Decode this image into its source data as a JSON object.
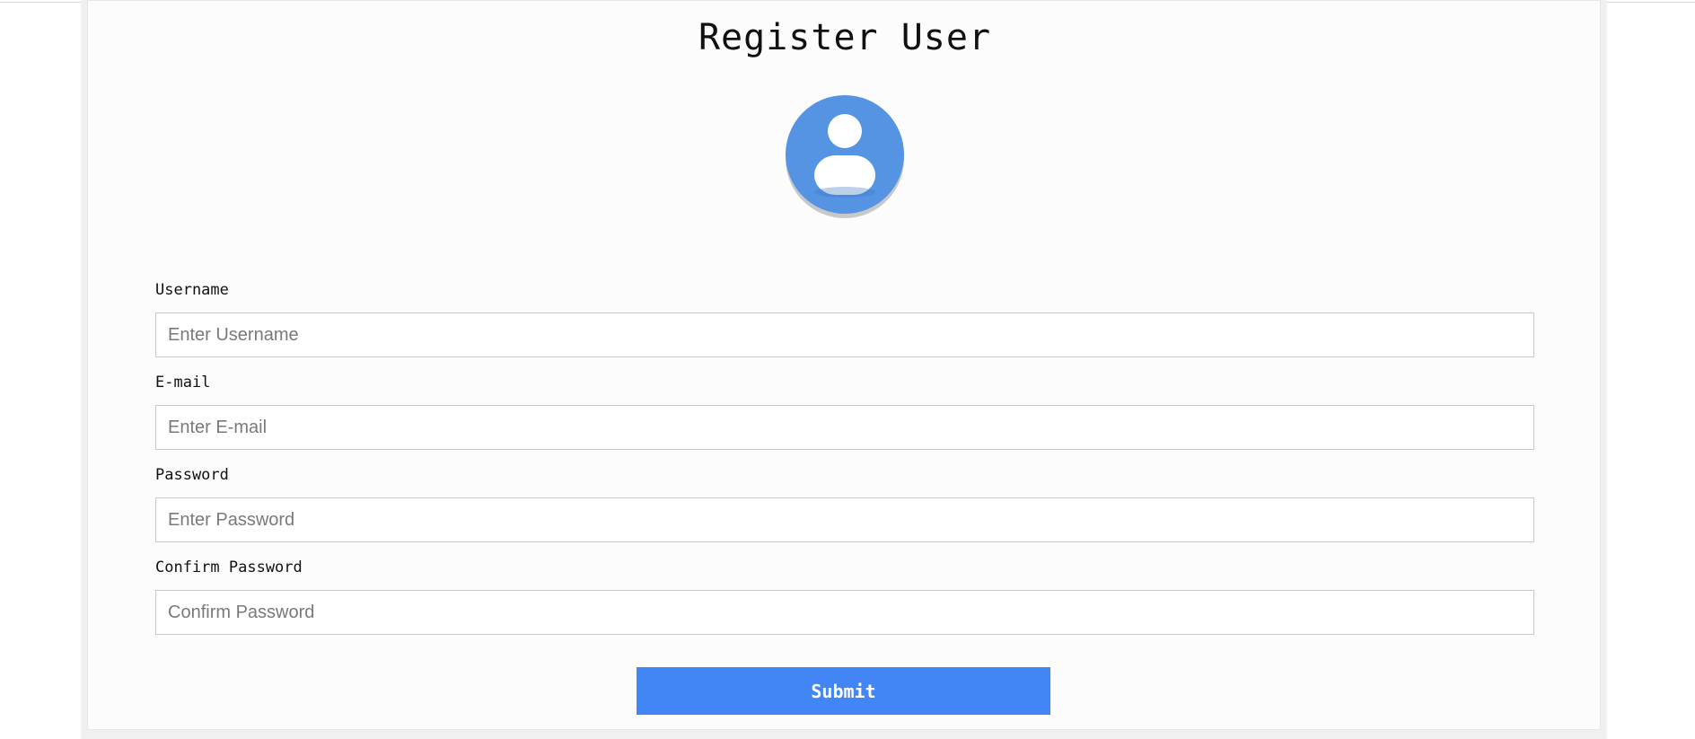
{
  "page": {
    "title": "Register User",
    "avatar_icon": "user-avatar-icon"
  },
  "form": {
    "fields": [
      {
        "label": "Username",
        "placeholder": "Enter Username",
        "value": ""
      },
      {
        "label": "E-mail",
        "placeholder": "Enter E-mail",
        "value": ""
      },
      {
        "label": "Password",
        "placeholder": "Enter Password",
        "value": ""
      },
      {
        "label": "Confirm Password",
        "placeholder": "Confirm Password",
        "value": ""
      }
    ],
    "submit_label": "Submit"
  },
  "colors": {
    "accent": "#4285f4",
    "avatar": "#5593e3"
  }
}
